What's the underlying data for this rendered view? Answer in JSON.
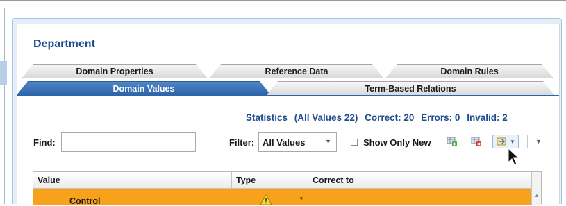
{
  "header": {
    "title": "Department"
  },
  "tabs_row1": [
    {
      "label": "Domain Properties"
    },
    {
      "label": "Reference Data"
    },
    {
      "label": "Domain Rules"
    }
  ],
  "tabs_row2": [
    {
      "label": "Domain Values",
      "active": true
    },
    {
      "label": "Term-Based Relations",
      "active": false
    }
  ],
  "statistics": {
    "label": "Statistics",
    "all_values": "(All Values 22)",
    "correct": "Correct: 20",
    "errors": "Errors: 0",
    "invalid": "Invalid: 2"
  },
  "toolbar": {
    "find_label": "Find:",
    "find_value": "",
    "filter_label": "Filter:",
    "filter_value": "All Values",
    "show_only_new_label": "Show Only New",
    "show_only_new_checked": false,
    "icons": [
      "add-value-icon",
      "delete-value-icon",
      "import-values-icon",
      "more-options-icon"
    ]
  },
  "grid": {
    "columns": [
      "Value",
      "Type",
      "Correct to"
    ],
    "rows": [
      {
        "value": "Control",
        "type": "warning-icon",
        "correct_to": ""
      }
    ]
  },
  "colors": {
    "accent": "#1f4d8f",
    "active_tab": "#2e64a9",
    "selected_row": "#f7a21a"
  }
}
